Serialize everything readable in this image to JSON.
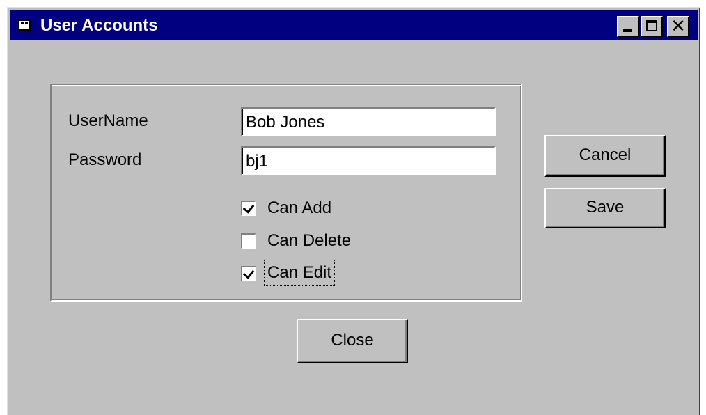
{
  "window": {
    "title": "User Accounts",
    "icon": "form-icon",
    "controls": [
      "minimize-icon",
      "maximize-icon",
      "close-icon"
    ],
    "close_glyph": "✕",
    "colors": {
      "titlebar": "#000080",
      "face": "#c0c0c0"
    }
  },
  "form": {
    "username": {
      "label": "UserName",
      "value": "Bob Jones"
    },
    "password": {
      "label": "Password",
      "value": "bj1"
    },
    "permissions": [
      {
        "label": "Can Add",
        "checked": true
      },
      {
        "label": "Can Delete",
        "checked": false
      },
      {
        "label": "Can Edit",
        "checked": true,
        "focused": true
      }
    ]
  },
  "buttons": {
    "cancel": "Cancel",
    "save": "Save",
    "close": "Close"
  }
}
